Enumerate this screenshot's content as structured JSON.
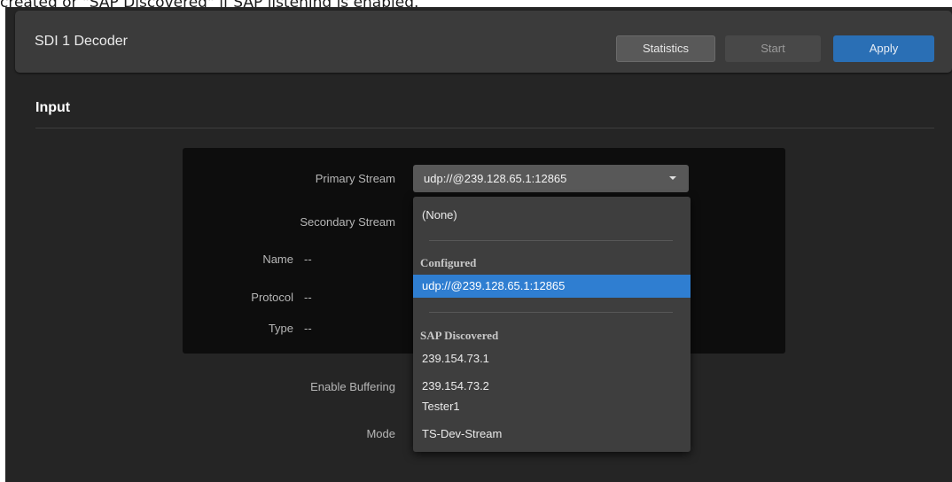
{
  "caption": "created or \"SAP Discovered\" if SAP listening is enabled.",
  "header": {
    "title": "SDI 1 Decoder",
    "statistics_label": "Statistics",
    "start_label": "Start",
    "apply_label": "Apply"
  },
  "section": {
    "title": "Input"
  },
  "form": {
    "primary_stream_label": "Primary Stream",
    "primary_stream_value": "udp://@239.128.65.1:12865",
    "secondary_stream_label": "Secondary Stream",
    "name_label": "Name",
    "name_value": "--",
    "protocol_label": "Protocol",
    "protocol_value": "--",
    "type_label": "Type",
    "type_value": "--",
    "enable_buffering_label": "Enable Buffering",
    "mode_label": "Mode"
  },
  "dropdown": {
    "none_option": "(None)",
    "configured_heading": "Configured",
    "configured_options": [
      "udp://@239.128.65.1:12865"
    ],
    "sap_heading": "SAP Discovered",
    "sap_options": [
      "239.154.73.1",
      "239.154.73.2",
      "Tester1",
      "TS-Dev-Stream"
    ]
  },
  "colors": {
    "accent": "#2a6fb5",
    "selected_option": "#2f7ed1",
    "background": "#252525"
  }
}
